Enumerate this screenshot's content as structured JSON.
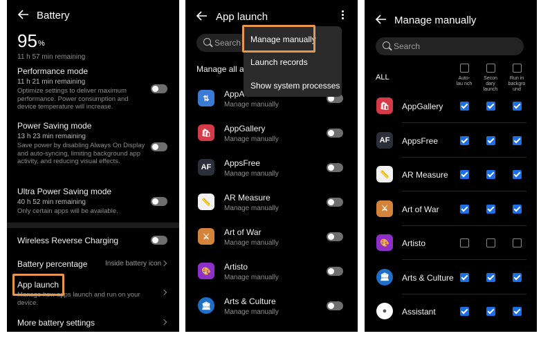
{
  "battery": {
    "title": "Battery",
    "percent": "95",
    "percent_sign": "%",
    "remaining": "11 h 57 min remaining",
    "performance": {
      "title": "Performance mode",
      "time": "11 h 21 min remaining",
      "desc": "Optimize settings to deliver maximum performance. Power consumption and device temperature will increase.",
      "on": false
    },
    "power_saving": {
      "title": "Power Saving mode",
      "time": "13 h 23 min remaining",
      "desc": "Save power by disabling Always On Display and auto-syncing, limiting background app activity, and reducing visual effects.",
      "on": false
    },
    "ultra": {
      "title": "Ultra Power Saving mode",
      "time": "40 h 52 min remaining",
      "desc": "Only certain apps will be available.",
      "on": false
    },
    "wireless": {
      "title": "Wireless Reverse Charging",
      "on": false
    },
    "percentage": {
      "title": "Battery percentage",
      "value": "Inside battery icon"
    },
    "app_launch": {
      "title": "App launch",
      "desc": "Manage how apps launch and run on your device."
    },
    "more": {
      "title": "More battery settings"
    }
  },
  "app_launch": {
    "title": "App launch",
    "search_placeholder": "Search",
    "manage_all": "Manage all au",
    "menu": [
      "Manage manually",
      "Launch records",
      "Show system processes"
    ],
    "apps": [
      {
        "name": "AppA",
        "status": "Manage manually",
        "icon": "appadvisor-icon",
        "color": "#3a7bd5"
      },
      {
        "name": "AppGallery",
        "status": "Manage manually",
        "icon": "appgallery-icon",
        "color": "#d63a48"
      },
      {
        "name": "AppsFree",
        "status": "Manage manually",
        "icon": "appsfree-icon",
        "color": "#2a2f3a"
      },
      {
        "name": "AR Measure",
        "status": "Manage manually",
        "icon": "ar-measure-icon",
        "color": "#f2f2f2"
      },
      {
        "name": "Art of War",
        "status": "Manage manually",
        "icon": "art-of-war-icon",
        "color": "#d4843a"
      },
      {
        "name": "Artisto",
        "status": "Manage manually",
        "icon": "artisto-icon",
        "color": "#8d2fc9"
      },
      {
        "name": "Arts & Culture",
        "status": "Manage manually",
        "icon": "arts-culture-icon",
        "color": "#1f6fc9"
      }
    ]
  },
  "manage": {
    "title": "Manage manually",
    "search_placeholder": "Search",
    "all_label": "ALL",
    "columns": [
      "Auto-launch",
      "Secondary launch",
      "Run in background"
    ],
    "column_display": [
      "Auto-lau nch",
      "Secon dary launch",
      "Run in backgro und"
    ],
    "apps": [
      {
        "name": "AppGallery",
        "icon": "appgallery-icon",
        "color": "#d63a48",
        "checks": [
          true,
          true,
          true
        ]
      },
      {
        "name": "AppsFree",
        "icon": "appsfree-icon",
        "color": "#2a2f3a",
        "checks": [
          true,
          true,
          true
        ]
      },
      {
        "name": "AR Measure",
        "icon": "ar-measure-icon",
        "color": "#f2f2f2",
        "checks": [
          true,
          true,
          true
        ]
      },
      {
        "name": "Art of War",
        "icon": "art-of-war-icon",
        "color": "#d4843a",
        "checks": [
          true,
          true,
          true
        ]
      },
      {
        "name": "Artisto",
        "icon": "artisto-icon",
        "color": "#8d2fc9",
        "checks": [
          false,
          false,
          false
        ]
      },
      {
        "name": "Arts & Culture",
        "icon": "arts-culture-icon",
        "color": "#1f6fc9",
        "checks": [
          true,
          true,
          true
        ]
      },
      {
        "name": "Assistant",
        "icon": "assistant-icon",
        "color": "#ffffff",
        "checks": [
          true,
          true,
          true
        ]
      }
    ]
  },
  "accent_colors": {
    "highlight": "#e9974e",
    "checkbox": "#1d6fe5",
    "background": "#000000"
  }
}
